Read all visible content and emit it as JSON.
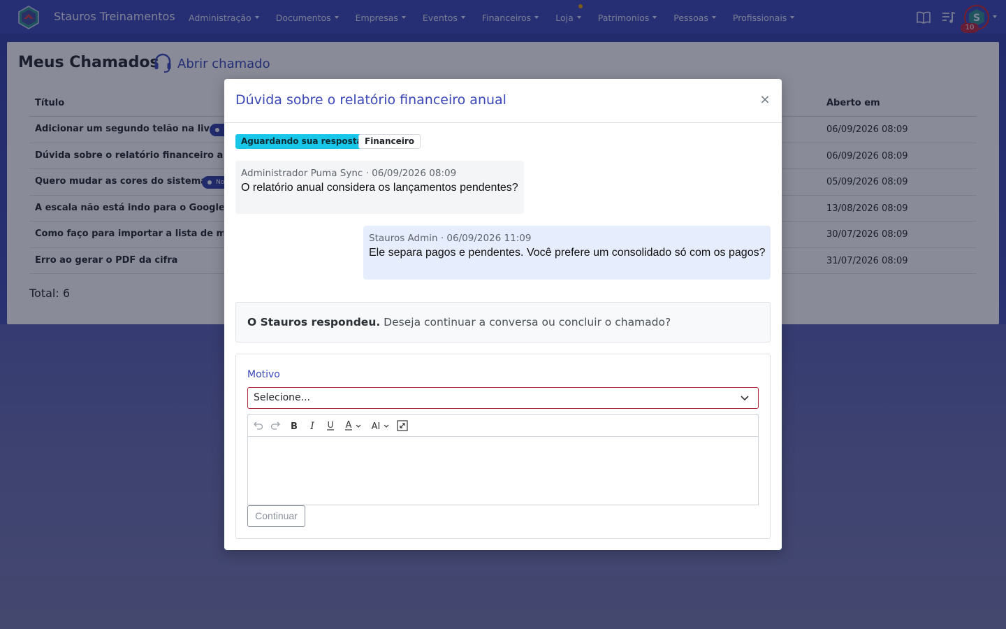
{
  "navbar": {
    "brand": "Stauros Treinamentos",
    "menu": [
      {
        "label": "Administração"
      },
      {
        "label": "Documentos"
      },
      {
        "label": "Empresas"
      },
      {
        "label": "Eventos"
      },
      {
        "label": "Financeiros"
      },
      {
        "label": "Loja"
      },
      {
        "label": "Patrimonios"
      },
      {
        "label": "Pessoas"
      },
      {
        "label": "Profissionais"
      }
    ],
    "right_icons": [
      "book-icon",
      "music-playlist-icon"
    ],
    "avatar_badge": "10",
    "notification_dot_color": "#e6a100"
  },
  "page": {
    "title": "Meus Chamados",
    "open_ticket_label": "Abrir chamado",
    "table": {
      "columns": [
        "Título",
        "Aberto em"
      ],
      "rows": [
        {
          "title": "Adicionar um segundo telão na live",
          "opened_at": "06/09/2026 08:09"
        },
        {
          "title": "Dúvida sobre o relatório financeiro anual",
          "opened_at": "06/09/2026 08:09"
        },
        {
          "title": "Quero mudar as cores do sistema",
          "opened_at": "05/09/2026 08:09",
          "pill": "No"
        },
        {
          "title": "A escala não está indo para o Google Calendar",
          "opened_at": "13/08/2026 08:09"
        },
        {
          "title": "Como faço para importar a lista de membros",
          "opened_at": "30/07/2026 08:09"
        },
        {
          "title": "Erro ao gerar o PDF da cifra",
          "opened_at": "31/07/2026 08:09"
        }
      ]
    },
    "total": "Total: 6"
  },
  "modal": {
    "title": "Dúvida sobre o relatório financeiro anual",
    "status_badge": "Aguardando sua resposta",
    "category_badge": "Financeiro",
    "messages": [
      {
        "meta": "Administrador Puma Sync · 06/09/2026 08:09",
        "text": "O relatório anual considera os lançamentos pendentes?"
      },
      {
        "meta": "Stauros Admin · 06/09/2026 11:09",
        "text": "Ele separa pagos e pendentes. Você prefere um consolidado só com os pagos?"
      }
    ],
    "notice_strong": "O Stauros respondeu.",
    "notice_text": " Deseja continuar a conversa ou concluir o chamado?",
    "form": {
      "reason_label": "Motivo",
      "reason_value": "Selecione...",
      "toolbar": [
        "undo-icon",
        "redo-icon",
        "bold-icon",
        "italic-icon",
        "underline-icon",
        "font-color-icon",
        "font-size-icon",
        "fullscreen-icon"
      ],
      "submit_label": "Continuar"
    }
  },
  "colors": {
    "navbar": "#3946b6",
    "accent": "#3a48b8",
    "status_badge": "#17c6e8",
    "invalid_border": "#b02c3b"
  }
}
